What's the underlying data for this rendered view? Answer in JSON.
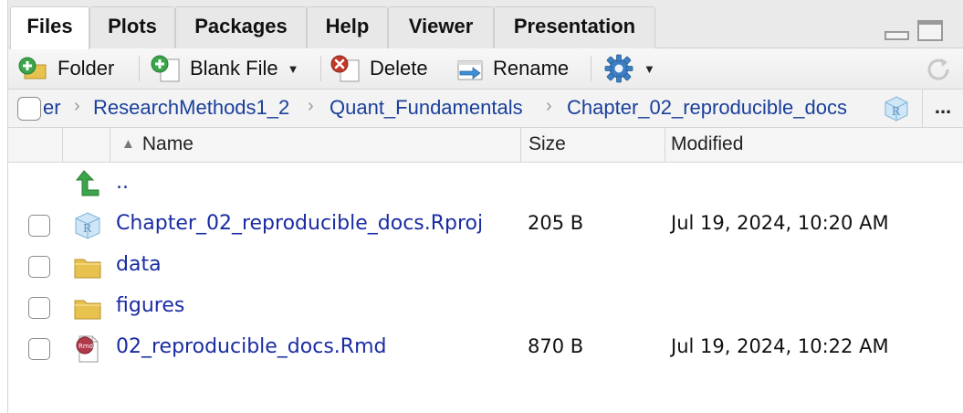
{
  "tabs": [
    {
      "label": "Files",
      "active": true
    },
    {
      "label": "Plots"
    },
    {
      "label": "Packages"
    },
    {
      "label": "Help"
    },
    {
      "label": "Viewer"
    },
    {
      "label": "Presentation"
    }
  ],
  "toolbar": {
    "new_folder": "Folder",
    "blank_file": "Blank File",
    "delete": "Delete",
    "rename": "Rename"
  },
  "breadcrumb": {
    "truncated": "er",
    "items": [
      "ResearchMethods1_2",
      "Quant_Fundamentals",
      "Chapter_02_reproducible_docs"
    ],
    "more": "..."
  },
  "columns": {
    "name": "Name",
    "size": "Size",
    "modified": "Modified"
  },
  "files": [
    {
      "icon": "parent-folder-icon",
      "name": "..",
      "size": "",
      "modified": ""
    },
    {
      "icon": "rproj-icon",
      "name": "Chapter_02_reproducible_docs.Rproj",
      "size": "205 B",
      "modified": "Jul 19, 2024, 10:20 AM"
    },
    {
      "icon": "folder-icon",
      "name": "data",
      "size": "",
      "modified": ""
    },
    {
      "icon": "folder-icon",
      "name": "figures",
      "size": "",
      "modified": ""
    },
    {
      "icon": "rmd-icon",
      "name": "02_reproducible_docs.Rmd",
      "size": "870 B",
      "modified": "Jul 19, 2024, 10:22 AM"
    }
  ],
  "colors": {
    "link": "#1a2ca3",
    "breadcrumb_link": "#1a3f9c",
    "folder": "#e8c24e",
    "up_arrow": "#3aa54a",
    "delete_icon": "#c0392b",
    "gear": "#3c7fc4"
  }
}
